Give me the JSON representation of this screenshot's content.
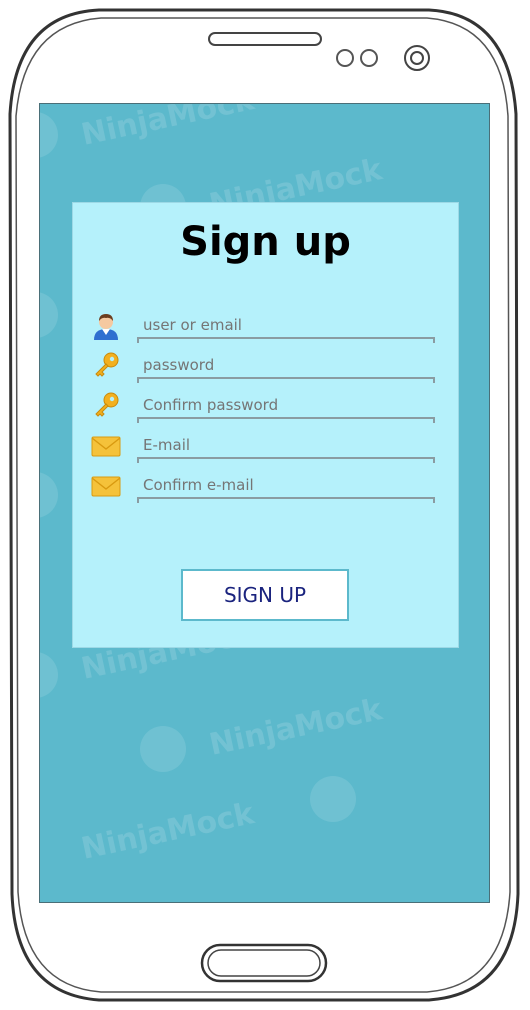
{
  "form": {
    "title": "Sign up",
    "fields": [
      {
        "icon": "user-icon",
        "placeholder": "user or email"
      },
      {
        "icon": "key-icon",
        "placeholder": "password"
      },
      {
        "icon": "key-icon",
        "placeholder": "Confirm password"
      },
      {
        "icon": "envelope-icon",
        "placeholder": "E-mail"
      },
      {
        "icon": "envelope-icon",
        "placeholder": "Confirm e-mail"
      }
    ],
    "submit_label": "SIGN UP"
  },
  "watermark": {
    "text": "NinjaMock"
  },
  "colors": {
    "screen_bg": "#5cb9cc",
    "card_bg": "#b5f1fb",
    "button_text": "#1a237e",
    "button_border": "#5cb9cc"
  }
}
